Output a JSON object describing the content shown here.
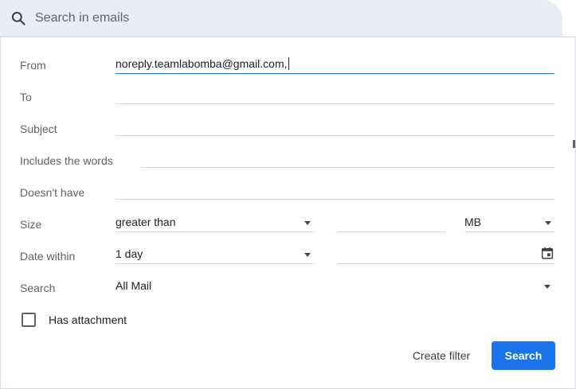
{
  "search": {
    "placeholder": "Search in emails",
    "icon": "search-icon"
  },
  "form": {
    "from": {
      "label": "From",
      "value": "noreply.teamlabomba@gmail.com,"
    },
    "to": {
      "label": "To",
      "value": ""
    },
    "subject": {
      "label": "Subject",
      "value": ""
    },
    "includes": {
      "label": "Includes the words",
      "value": ""
    },
    "doesnt_have": {
      "label": "Doesn't have",
      "value": ""
    },
    "size": {
      "label": "Size",
      "comparator": "greater than",
      "value": "",
      "unit": "MB"
    },
    "date_within": {
      "label": "Date within",
      "range": "1 day",
      "date": ""
    },
    "search_in": {
      "label": "Search",
      "scope": "All Mail"
    },
    "has_attachment": {
      "label": "Has attachment",
      "checked": false
    }
  },
  "actions": {
    "create_filter": "Create filter",
    "search": "Search"
  },
  "colors": {
    "accent": "#1a73e8",
    "search_bar_bg": "#e9eef6",
    "label": "#5f6368"
  }
}
